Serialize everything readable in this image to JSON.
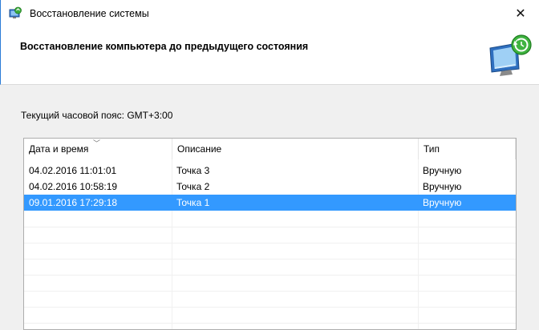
{
  "window": {
    "title": "Восстановление системы",
    "close_glyph": "✕"
  },
  "header": {
    "title": "Восстановление компьютера до предыдущего состояния",
    "icon": "system-restore-icon"
  },
  "timezone_label": "Текущий часовой пояс: GMT+3:00",
  "table": {
    "columns": [
      "Дата и время",
      "Описание",
      "Тип"
    ],
    "sorted_column": 0,
    "rows": [
      {
        "date": "04.02.2016 11:01:01",
        "description": "Точка 3",
        "type": "Вручную",
        "selected": false
      },
      {
        "date": "04.02.2016 10:58:19",
        "description": "Точка 2",
        "type": "Вручную",
        "selected": false
      },
      {
        "date": "09.01.2016 17:29:18",
        "description": "Точка 1",
        "type": "Вручную",
        "selected": true
      }
    ]
  },
  "colors": {
    "selection": "#3399ff",
    "window_border": "#2b7bd6"
  }
}
